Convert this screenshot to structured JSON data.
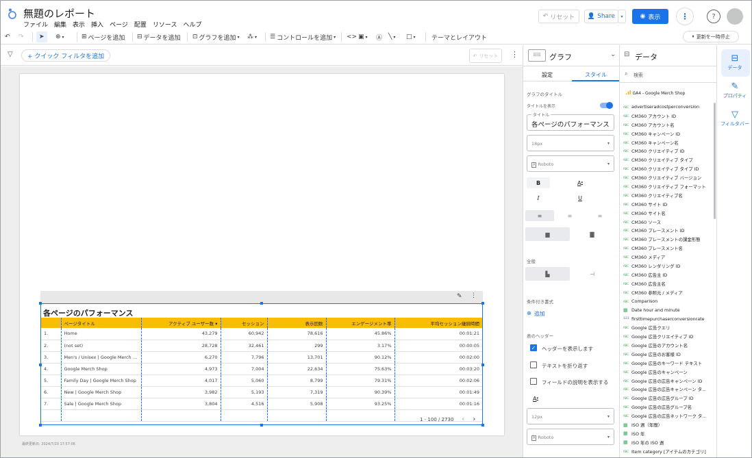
{
  "header": {
    "title": "無題のレポート",
    "menu": [
      "ファイル",
      "編集",
      "表示",
      "挿入",
      "ページ",
      "配置",
      "リソース",
      "ヘルプ"
    ],
    "reset_label": "リセット",
    "share_label": "Share",
    "view_label": "表示"
  },
  "toolbar": {
    "add_page": "ページを追加",
    "add_data": "データを追加",
    "add_chart": "グラフを追加",
    "add_control": "コントロールを追加",
    "theme_layout": "テーマとレイアウト",
    "pause_updates": "更新を一時停止"
  },
  "filterbar": {
    "quick_filter": "+ クイック フィルタを追加",
    "reset_label": "リセット"
  },
  "report_table": {
    "title": "各ページのパフォーマンス",
    "columns": [
      "",
      "ページタイトル",
      "アクティブ ユーザー数 ▾",
      "セッション",
      "表示回数",
      "エンゲージメント率",
      "平均セッション継続時間"
    ],
    "rows": [
      [
        "1.",
        "Home",
        "43,279",
        "60,942",
        "78,616",
        "45.86%",
        "00:01:21"
      ],
      [
        "2.",
        "(not set)",
        "28,728",
        "32,461",
        "299",
        "3.17%",
        "00:00:05"
      ],
      [
        "3.",
        "Men's / Unisex | Google Merch S...",
        "6,270",
        "7,796",
        "13,701",
        "90.12%",
        "00:02:00"
      ],
      [
        "4.",
        "Google Merch Shop",
        "4,973",
        "7,004",
        "22,634",
        "75.63%",
        "00:03:20"
      ],
      [
        "5.",
        "Family Day | Google Merch Shop",
        "4,017",
        "5,060",
        "8,799",
        "79.31%",
        "00:02:06"
      ],
      [
        "6.",
        "New | Google Merch Shop",
        "3,982",
        "5,193",
        "7,319",
        "90.39%",
        "00:01:49"
      ],
      [
        "7.",
        "Sale | Google Merch Shop",
        "3,804",
        "4,516",
        "5,908",
        "93.25%",
        "00:01:16"
      ]
    ],
    "pagination": "1 - 100 / 2730"
  },
  "last_updated": "最終更新日: 2024/7/20 17:57:06",
  "properties": {
    "panel_title": "グラフ",
    "tab_setup": "設定",
    "tab_style": "スタイル",
    "chart_title_section": "グラフのタイトル",
    "show_title_label": "タイトルを表示",
    "title_field_label": "タイトル",
    "title_value": "各ページのパフォーマンス",
    "font_size": "18px",
    "font_family": "Roboto",
    "bold": "B",
    "italic": "I",
    "underline": "U",
    "font_color": "A",
    "overall_section": "全般",
    "conditional_section": "条件付き書式",
    "add_label": "追加",
    "table_header_section": "表のヘッダー",
    "show_header": "ヘッダーを表示します",
    "wrap_text": "テキストを折り返す",
    "show_field_desc": "フィールドの説明を表示する",
    "font_size2": "12px",
    "font_family2": "Roboto"
  },
  "data_panel": {
    "title": "データ",
    "search_placeholder": "検索",
    "source_name": "GA4 - Google Merch Shop",
    "fields": [
      {
        "type": "ABC",
        "name": "advertiseradcostperconversion"
      },
      {
        "type": "ABC",
        "name": "CM360 アカウント ID"
      },
      {
        "type": "ABC",
        "name": "CM360 アカウント名"
      },
      {
        "type": "ABC",
        "name": "CM360 キャンペーン ID"
      },
      {
        "type": "ABC",
        "name": "CM360 キャンペーン名"
      },
      {
        "type": "ABC",
        "name": "CM360 クリエイティブ ID"
      },
      {
        "type": "ABC",
        "name": "CM360 クリエイティブ タイプ"
      },
      {
        "type": "ABC",
        "name": "CM360 クリエイティブ タイプ ID"
      },
      {
        "type": "ABC",
        "name": "CM360 クリエイティブ バージョン"
      },
      {
        "type": "ABC",
        "name": "CM360 クリエイティブ フォーマット"
      },
      {
        "type": "ABC",
        "name": "CM360 クリエイティブ名"
      },
      {
        "type": "ABC",
        "name": "CM360 サイト ID"
      },
      {
        "type": "ABC",
        "name": "CM360 サイト名"
      },
      {
        "type": "ABC",
        "name": "CM360 ソース"
      },
      {
        "type": "ABC",
        "name": "CM360 プレースメント ID"
      },
      {
        "type": "ABC",
        "name": "CM360 プレースメントの課金形態"
      },
      {
        "type": "ABC",
        "name": "CM360 プレースメント名"
      },
      {
        "type": "ABC",
        "name": "CM360 メディア"
      },
      {
        "type": "ABC",
        "name": "CM360 レンダリング ID"
      },
      {
        "type": "ABC",
        "name": "CM360 広告主 ID"
      },
      {
        "type": "ABC",
        "name": "CM360 広告主名"
      },
      {
        "type": "ABC",
        "name": "CM360 参照元 / メディア"
      },
      {
        "type": "ABC",
        "name": "Comparison"
      },
      {
        "type": "CAL",
        "name": "Date hour and minute"
      },
      {
        "type": "123",
        "name": "firsttimepurchaserconversionrate"
      },
      {
        "type": "ABC",
        "name": "Google 広告クエリ"
      },
      {
        "type": "ABC",
        "name": "Google 広告クリエイティブ ID"
      },
      {
        "type": "ABC",
        "name": "Google 広告のアカウント名"
      },
      {
        "type": "ABC",
        "name": "Google 広告のお客様 ID"
      },
      {
        "type": "ABC",
        "name": "Google 広告のキーワード テキスト"
      },
      {
        "type": "ABC",
        "name": "Google 広告のキャンペーン"
      },
      {
        "type": "ABC",
        "name": "Google 広告の広告キャンペーン ID"
      },
      {
        "type": "ABC",
        "name": "Google 広告の広告キャンペーン タ..."
      },
      {
        "type": "ABC",
        "name": "Google 広告の広告グループ ID"
      },
      {
        "type": "ABC",
        "name": "Google 広告の広告グループ名"
      },
      {
        "type": "ABC",
        "name": "Google 広告の広告ネットワーク タ..."
      },
      {
        "type": "CAL",
        "name": "ISO 週（年間）"
      },
      {
        "type": "CAL",
        "name": "ISO 年"
      },
      {
        "type": "CAL",
        "name": "ISO 年の ISO 週"
      },
      {
        "type": "ABC",
        "name": "Item category [アイテムのカテゴリ]"
      }
    ]
  },
  "rail": {
    "data": "データ",
    "properties": "プロパティ",
    "filter": "フィルタバー"
  }
}
